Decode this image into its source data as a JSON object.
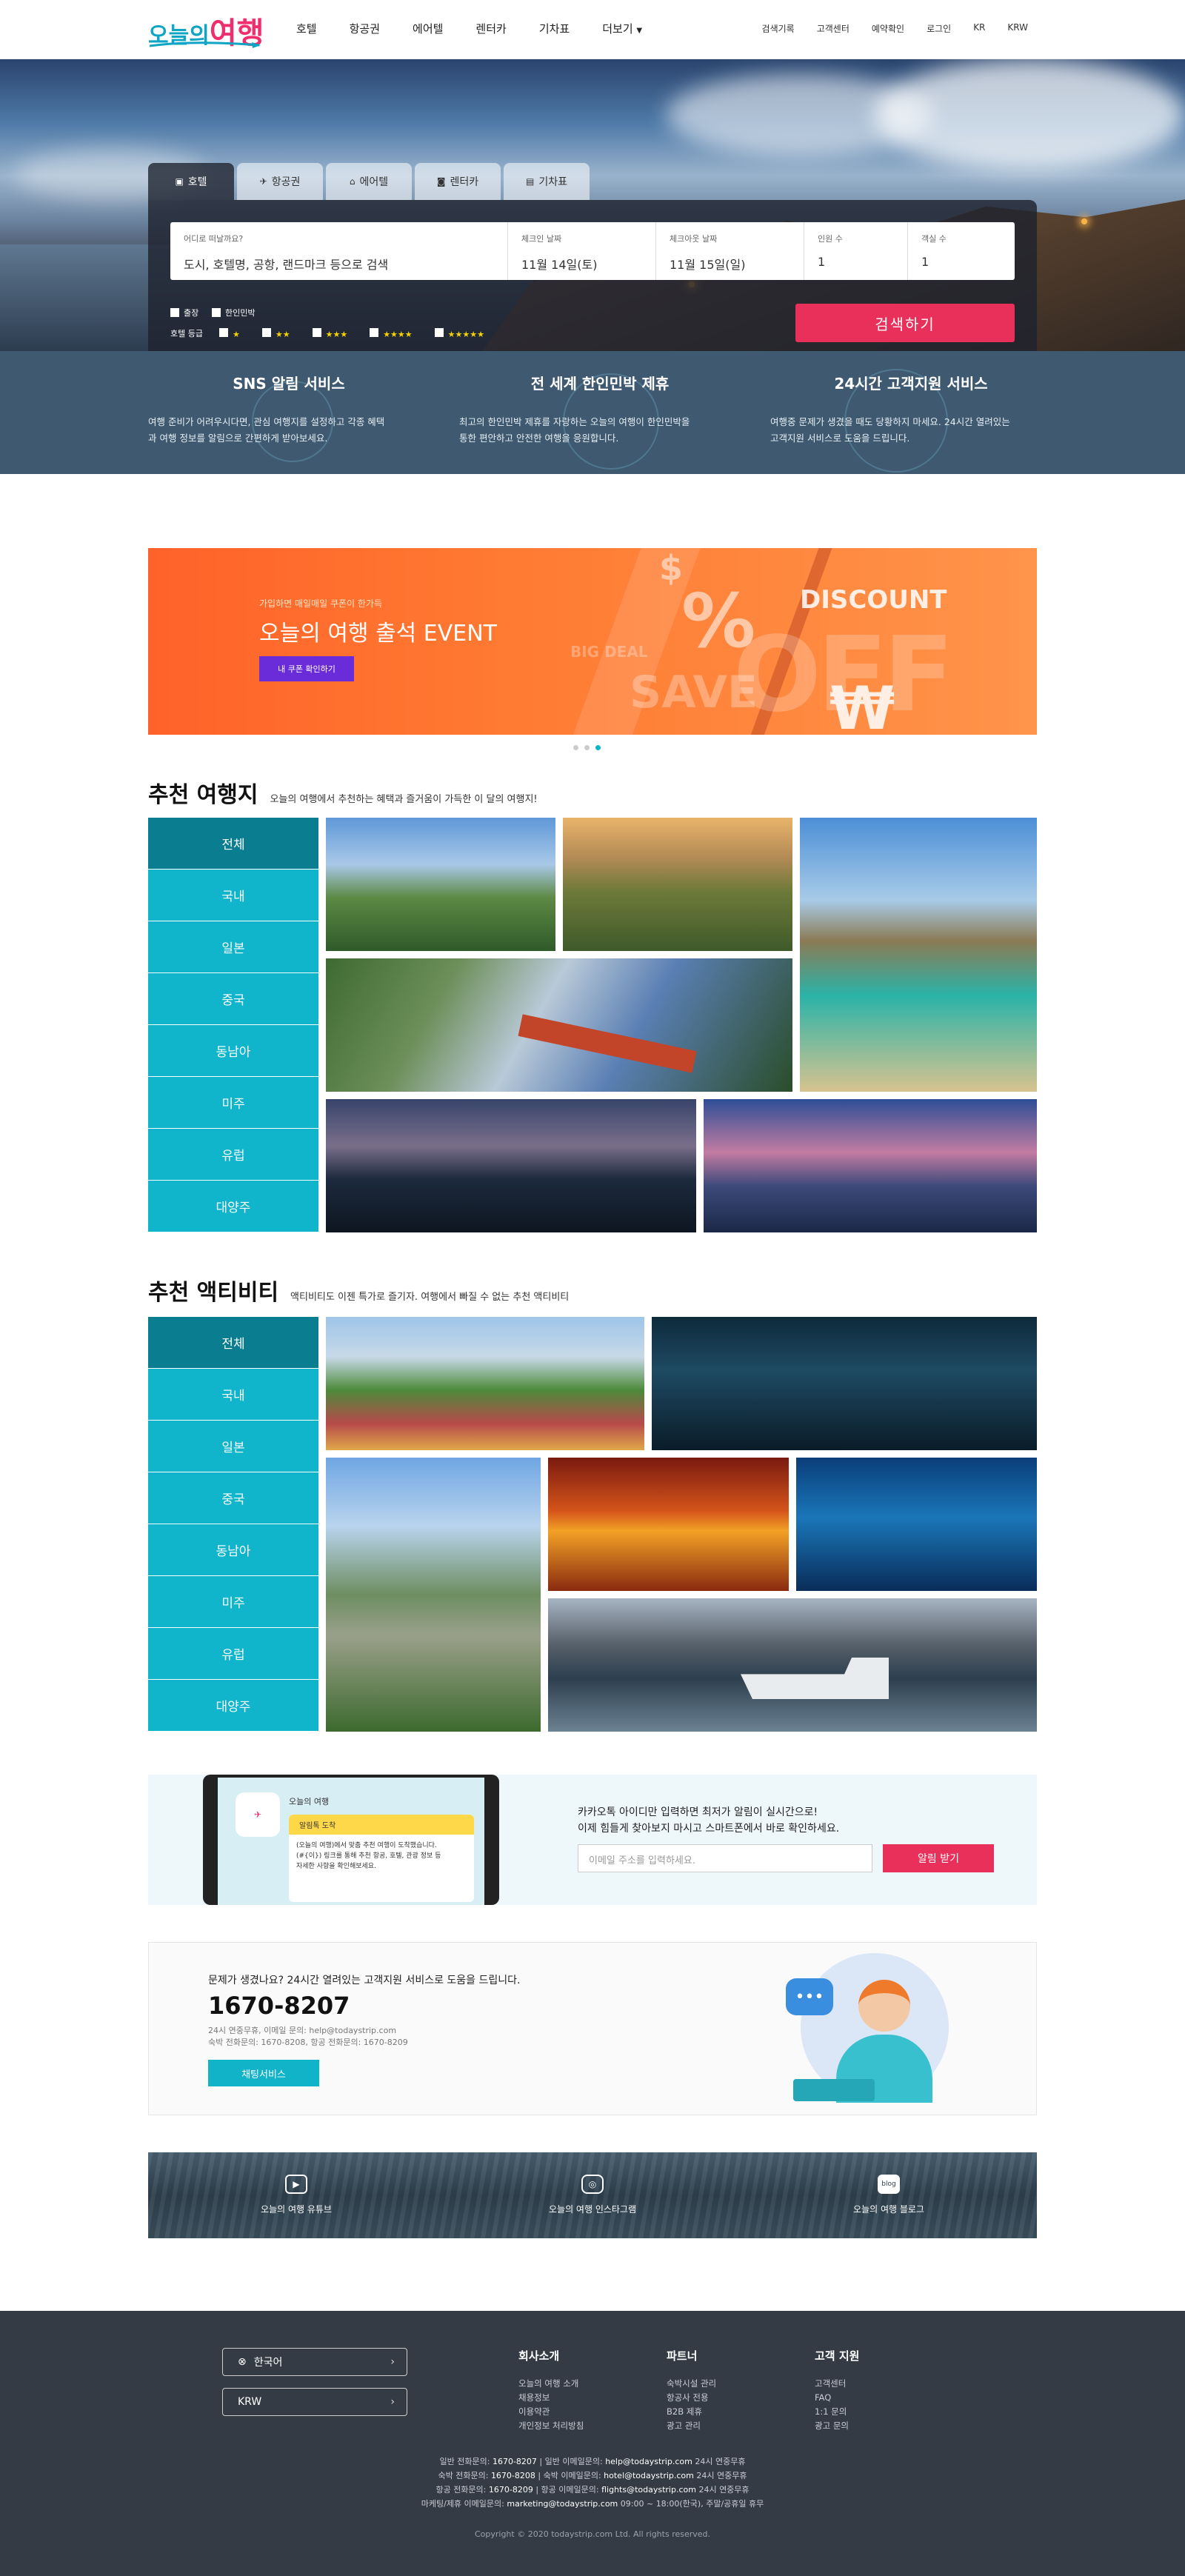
{
  "header": {
    "logo_part1": "오늘의",
    "logo_part2": "여행",
    "nav": [
      "호텔",
      "항공권",
      "에어텔",
      "렌터카",
      "기차표",
      "더보기"
    ],
    "util": [
      "검색기록",
      "고객센터",
      "예약확인",
      "로그인",
      "KR",
      "KRW"
    ]
  },
  "search": {
    "tabs": [
      "호텔",
      "항공권",
      "에어텔",
      "렌터카",
      "기차표"
    ],
    "fields": [
      {
        "label": "어디로 떠날까요?",
        "value": "도시, 호텔명, 공항, 랜드마크 등으로 검색"
      },
      {
        "label": "체크인 날짜",
        "value": "11월 14일(토)"
      },
      {
        "label": "체크아웃 날짜",
        "value": "11월 15일(일)"
      },
      {
        "label": "인원 수",
        "value": "1"
      },
      {
        "label": "객실 수",
        "value": "1"
      }
    ],
    "options": [
      "출장",
      "한인민박"
    ],
    "grade_label": "호텔 등급",
    "grade_stars": [
      1,
      2,
      3,
      4,
      5
    ],
    "button": "검색하기"
  },
  "services": [
    {
      "title": "SNS 알림 서비스",
      "lines": [
        "여행 준비가 어려우시다면, 관심 여행지를 설정하고 각종 혜택",
        "과 여행 정보를 알림으로 간편하게 받아보세요."
      ]
    },
    {
      "title": "전 세계 한인민박 제휴",
      "lines": [
        "최고의 한인민박 제휴를 자랑하는 오늘의 여행이 한인민박을",
        "통한 편안하고 안전한 여행을 응원합니다."
      ]
    },
    {
      "title": "24시간 고객지원 서비스",
      "lines": [
        "여행중 문제가 생겼을 때도 당황하지 마세요. 24시간 열려있는",
        "고객지원 서비스로 도움을 드립니다."
      ]
    }
  ],
  "banner": {
    "sub": "가입하면 매일매일 쿠폰이 한가득",
    "title": "오늘의 여행 출석 EVENT",
    "button": "내 쿠폰 확인하기",
    "deco": [
      "DISCOUNT",
      "OFF",
      "SAVE",
      "BIG DEAL",
      "%",
      "$",
      "₩"
    ]
  },
  "recommend": {
    "title": "추천 여행지",
    "desc": "오늘의 여행에서 추천하는 혜택과 즐거움이 가득한 이 달의 여행지!",
    "categories": [
      "전체",
      "국내",
      "일본",
      "중국",
      "동남아",
      "미주",
      "유럽",
      "대양주"
    ]
  },
  "activity": {
    "title": "추천 액티비티",
    "desc": "액티비티도 이젠 특가로 즐기자. 여행에서 빠질 수 없는 추천 액티비티",
    "categories": [
      "전체",
      "국내",
      "일본",
      "중국",
      "동남아",
      "미주",
      "유럽",
      "대양주"
    ]
  },
  "app_promo": {
    "phone_app": "오늘의 여행",
    "phone_badge": "알림톡 도착",
    "phone_msg": [
      "(오늘의 여행)에서 맞춤 추천 여행이 도착했습니다.",
      "(#{이}) 링크를 통해 추천 항공, 호텔, 관광 정보 등",
      "자세한 사항을 확인해보세요."
    ],
    "line1": "카카오톡 아이디만 입력하면 최저가 알림이 실시간으로!",
    "line2": "이제 힘들게 찾아보지 마시고 스마트폰에서 바로 확인하세요.",
    "input_placeholder": "이메일 주소를 입력하세요.",
    "button": "알림 받기"
  },
  "cs": {
    "question": "문제가 생겼나요? 24시간 열려있는 고객지원 서비스로 도움을 드립니다.",
    "phone": "1670-8207",
    "line1": "24시 연중무휴, 이메일 문의: help@todaystrip.com",
    "line2": "숙박 전화문의: 1670-8208, 항공 전화문의: 1670-8209",
    "button": "채팅서비스"
  },
  "sns": [
    {
      "icon": "youtube-icon",
      "label": "오늘의 여행 유튜브"
    },
    {
      "icon": "instagram-icon",
      "label": "오늘의 여행 인스타그램"
    },
    {
      "icon": "blog-icon",
      "label": "오늘의 여행 블로그"
    }
  ],
  "footer": {
    "lang": "한국어",
    "currency": "KRW",
    "columns": [
      {
        "title": "회사소개",
        "items": [
          "오늘의 여행 소개",
          "채용정보",
          "이용약관",
          "개인정보 처리방침"
        ]
      },
      {
        "title": "파트너",
        "items": [
          "숙박시설 관리",
          "항공사 전용",
          "B2B 제휴",
          "광고 관리"
        ]
      },
      {
        "title": "고객 지원",
        "items": [
          "고객센터",
          "FAQ",
          "1:1 문의",
          "광고 문의"
        ]
      }
    ],
    "info": [
      {
        "pre": "일반 전화문의: ",
        "n1": "1670-8207",
        "mid": " | 일반 이메일문의: ",
        "n2": "help@todaystrip.com",
        "post": " 24시 연중무휴"
      },
      {
        "pre": "숙박 전화문의: ",
        "n1": "1670-8208",
        "mid": " | 숙박 이메일문의: ",
        "n2": "hotel@todaystrip.com",
        "post": " 24시 연중무휴"
      },
      {
        "pre": "항공 전화문의: ",
        "n1": "1670-8209",
        "mid": " | 항공 이메일문의: ",
        "n2": "flights@todaystrip.com",
        "post": " 24시 연중무휴"
      },
      {
        "pre": "마케팅/제휴 이메일문의: ",
        "n1": "marketing@todaystrip.com",
        "mid": " 09:00 ~ 18:00(한국), 주말/공휴일 휴무",
        "n2": "",
        "post": ""
      }
    ],
    "copyright": "Copyright © 2020 todaystrip.com Ltd. All rights reserved."
  },
  "colors": {
    "accent": "#10b5cb",
    "accent_dark": "#0b7d91",
    "primary_red": "#e8305a",
    "footer_bg": "#353b45",
    "service_bg": "#3f5a70"
  }
}
